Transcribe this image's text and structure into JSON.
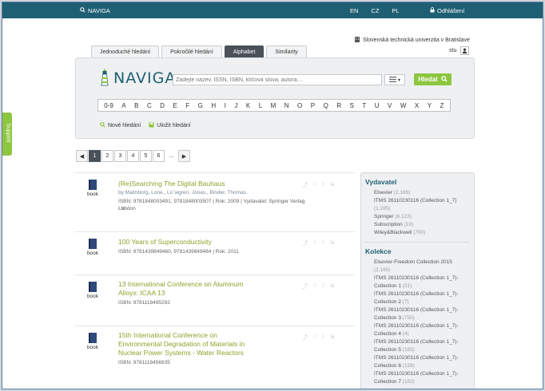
{
  "topbar": {
    "brand": "NAVIGA",
    "langs": [
      "EN",
      "CZ",
      "PL"
    ],
    "logout": "Odhlášení"
  },
  "support": "Support",
  "institution": "Slovenská technická univerzita v Bratislave",
  "user": "stu",
  "tabs": [
    "Jednoduché hledání",
    "Pokročilé hledání",
    "Alphabet",
    "Similarity"
  ],
  "active_tab": "Alphabet",
  "logo": "NAVIGA",
  "search": {
    "placeholder": "Zadejte název, ISSN, ISBN, klíčová slova, autora....",
    "button": "Hledat"
  },
  "alphabet": [
    "0-9",
    "A",
    "B",
    "C",
    "D",
    "E",
    "F",
    "G",
    "H",
    "I",
    "J",
    "K",
    "L",
    "M",
    "N",
    "O",
    "P",
    "Q",
    "R",
    "S",
    "T",
    "U",
    "V",
    "W",
    "X",
    "Y",
    "Z"
  ],
  "links": {
    "new": "Nové hledání",
    "save": "Uložit hledání"
  },
  "pagination": {
    "pages": [
      "1",
      "2",
      "3",
      "4",
      "5",
      "6"
    ],
    "dots": "...",
    "current": "1"
  },
  "results": [
    {
      "type": "book",
      "title": "(Re)Searching The Digital Bauhaus",
      "authors": "by Malmborg, Lone., Lo¨wgren, Jonas., Binder, Thomas",
      "meta1": "ISBN: 9781848003491, 9781848003507   |   Rok: 2009   |   Vydavatel: Springer Verlag London",
      "meta2": "Ltd"
    },
    {
      "type": "book",
      "title": "100 Years of Superconductivity",
      "meta1": "ISBN: 9781439849460, 9781439849484   |   Rok: 2011"
    },
    {
      "type": "book",
      "title": "13 International Conference on Aluminum Alloys: ICAA 13",
      "meta1": "ISBN: 9781118495292"
    },
    {
      "type": "book",
      "title": "15th International Conference on Environmental Degradation of Materials in Nuclear Power Systems - Water Reactors",
      "meta1": "ISBN: 9781118456835"
    }
  ],
  "facets": {
    "publisher_title": "Vydavatel",
    "publishers": [
      {
        "name": "Elsevier",
        "count": "(2,165)"
      },
      {
        "name": "ITMS 26110230116 (Collection 1_7)",
        "count": "(1,285)"
      },
      {
        "name": "Springer",
        "count": "(6,123)"
      },
      {
        "name": "Subscription",
        "count": "(19)"
      },
      {
        "name": "Wiley&Blackwell",
        "count": "(760)"
      }
    ],
    "collection_title": "Kolekce",
    "collections": [
      {
        "name": "Elsevier-Freedom Collection 2015",
        "count": "(2,165)"
      },
      {
        "name": "ITMS 26110230116 (Collection 1_7)-Collection 1",
        "count": "(31)"
      },
      {
        "name": "ITMS 26110230116 (Collection 1_7)-Collection 2",
        "count": "(7)"
      },
      {
        "name": "ITMS 26110230116 (Collection 1_7)-Collection 3",
        "count": "(750)"
      },
      {
        "name": "ITMS 26110230116 (Collection 1_7)-Collection 4",
        "count": "(4)"
      },
      {
        "name": "ITMS 26110230116 (Collection 1_7)-Collection 5",
        "count": "(183)"
      },
      {
        "name": "ITMS 26110230116 (Collection 1_7)-Collection 6",
        "count": "(128)"
      },
      {
        "name": "ITMS 26110230116 (Collection 1_7)-Collection 7",
        "count": "(182)"
      }
    ]
  },
  "colors": {
    "topbar": "#1f5f73",
    "accent": "#8dc63f",
    "title": "#8aa52a"
  }
}
